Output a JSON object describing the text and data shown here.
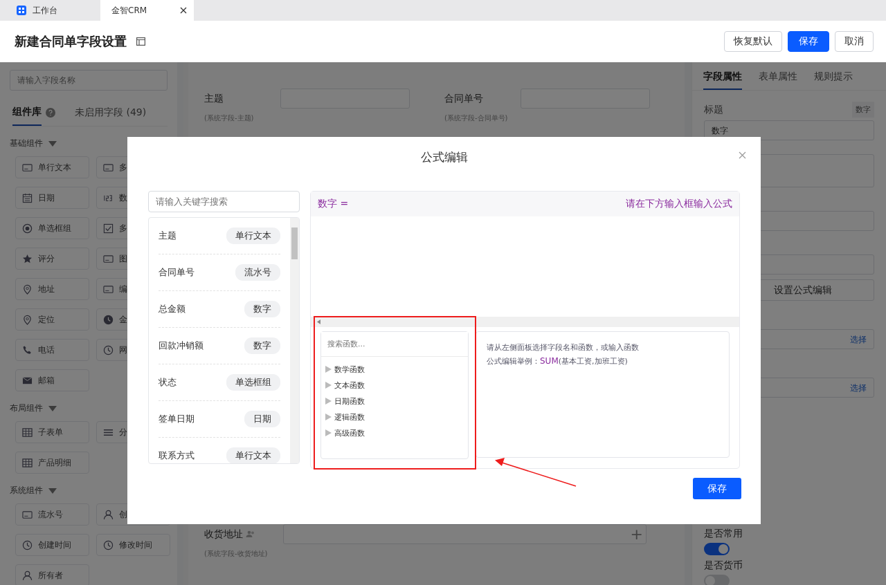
{
  "browser_tabs": [
    {
      "label": "工作台",
      "selected": false
    },
    {
      "label": "金智CRM",
      "selected": true
    }
  ],
  "header": {
    "title": "新建合同单字段设置",
    "buttons": [
      {
        "label": "恢复默认",
        "kind": "default"
      },
      {
        "label": "保存",
        "kind": "primary"
      },
      {
        "label": "取消",
        "kind": "default"
      }
    ]
  },
  "sidebar": {
    "search_placeholder": "请输入字段名称",
    "tabs": [
      {
        "label": "组件库",
        "selected": true
      },
      {
        "label": "未启用字段 (49)",
        "selected": false
      }
    ],
    "groups": [
      {
        "title": "基础组件",
        "items": [
          "单行文本",
          "多",
          "日期",
          "数",
          "单选框组",
          "多",
          "评分",
          "图",
          "地址",
          "编",
          "定位",
          "金",
          "电话",
          "网",
          "邮箱"
        ]
      },
      {
        "title": "布局组件",
        "items": [
          "子表单",
          "分",
          "产品明细"
        ]
      },
      {
        "title": "系统组件",
        "items": [
          "流水号",
          "创",
          "创建时间",
          "修改时间",
          "所有者"
        ]
      }
    ]
  },
  "form": {
    "top_fields": [
      {
        "label": "主题",
        "hint": "(系统字段-主题)"
      },
      {
        "label": "合同单号",
        "hint": "(系统字段-合同单号)"
      }
    ],
    "address_field": {
      "label": "收货地址",
      "hint": "(系统字段-收货地址)",
      "add": "+"
    }
  },
  "properties": {
    "tabs": [
      {
        "label": "字段属性",
        "selected": true
      },
      {
        "label": "表单属性",
        "selected": false
      },
      {
        "label": "规则提示",
        "selected": false
      }
    ],
    "title_label": "标题",
    "title_tag": "数字",
    "title_value": "数字",
    "formula_button": "设置公式编辑",
    "select_links": [
      "选择",
      "选择"
    ],
    "toggles": [
      {
        "label": "是否常用",
        "on": true
      },
      {
        "label": "是否货币",
        "on": false
      }
    ]
  },
  "modal": {
    "title": "公式编辑",
    "search_placeholder": "请输入关键字搜索",
    "fields": [
      {
        "name": "主题",
        "type": "单行文本"
      },
      {
        "name": "合同单号",
        "type": "流水号"
      },
      {
        "name": "总金额",
        "type": "数字"
      },
      {
        "name": "回款冲销额",
        "type": "数字"
      },
      {
        "name": "状态",
        "type": "单选框组"
      },
      {
        "name": "签单日期",
        "type": "日期"
      },
      {
        "name": "联系方式",
        "type": "单行文本"
      }
    ],
    "formula_target": "数字 =",
    "formula_hint": "请在下方输入框输入公式",
    "function_search_placeholder": "搜索函数...",
    "function_groups": [
      {
        "label": "数学函数",
        "expanded": false
      },
      {
        "label": "文本函数",
        "expanded": false
      },
      {
        "label": "日期函数",
        "expanded": false
      },
      {
        "label": "逻辑函数",
        "expanded": false
      },
      {
        "label": "高级函数",
        "expanded": false
      }
    ],
    "help_line": "请从左侧面板选择字段名和函数，或输入函数",
    "example": {
      "prefix": "公式编辑举例：",
      "code": "SUM",
      "rest": "(基本工资,加班工资)"
    },
    "save": "保存"
  }
}
